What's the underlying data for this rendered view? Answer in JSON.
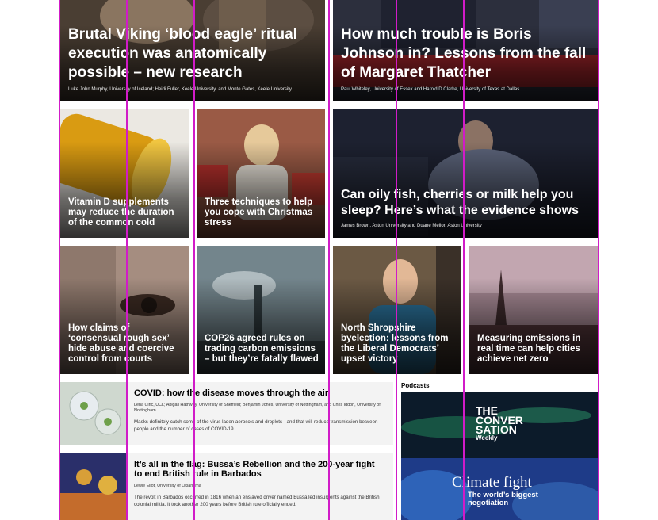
{
  "articles": {
    "viking": {
      "title": "Brutal Viking ‘blood eagle’ ritual execution was anatomically possible – new research",
      "authors": "Luke John Murphy, University of Iceland; Heidi Fuller, Keele University, and Monte Gates, Keele University"
    },
    "boris": {
      "title": "How much trouble is Boris Johnson in? Lessons from the fall of Margaret Thatcher",
      "authors": "Paul Whiteley, University of Essex and Harold D Clarke, University of Texas at Dallas"
    },
    "vitamin": {
      "title": "Vitamin D supplements may reduce the duration of the common cold"
    },
    "christmas": {
      "title": "Three techniques to help you cope with Christmas stress"
    },
    "sleep": {
      "title": "Can oily fish, cherries or milk help you sleep? Here’s what the evidence shows",
      "authors": "James Brown, Aston University and Duane Mellor, Aston University"
    },
    "rough_sex": {
      "title": "How claims of ‘consensual rough sex’ hide abuse and coercive control from courts"
    },
    "cop26": {
      "title": "COP26 agreed rules on trading carbon emissions – but they’re fatally flawed"
    },
    "shropshire": {
      "title": "North Shropshire byelection: lessons from the Liberal Democrats’ upset victory"
    },
    "emissions": {
      "title": "Measuring emissions in real time can help cities achieve net zero"
    },
    "covid": {
      "title": "COVID: how the disease moves through the air",
      "authors": "Lena Ciric, UCL; Abigail Hathway, University of Sheffield; Benjamin Jones, University of Nottingham, and Chris Iddon, University of Nottingham",
      "excerpt": "Masks definitely catch some of the virus laden aerosols and droplets - and that will reduce transmission between people and the number of cases of COVID-19."
    },
    "bussa": {
      "title": "It’s all in the flag: Bussa’s Rebellion and the 200-year fight to end British rule in Barbados",
      "authors": "Lewie Eliot, University of Oklahoma",
      "excerpt": "The revolt in Barbados occurred in 1816 when an enslaved driver named Bussa led insurgents against the British colonial militia. It took another 200 years before British rule officially ended."
    }
  },
  "podcasts": {
    "label": "Podcasts",
    "logo_line1": "THE",
    "logo_line2": "CONVER",
    "logo_line3": "SATION",
    "logo_line4": "Weekly",
    "episode_title": "Climate fight",
    "episode_subtitle": "The world’s biggest negotiation"
  }
}
